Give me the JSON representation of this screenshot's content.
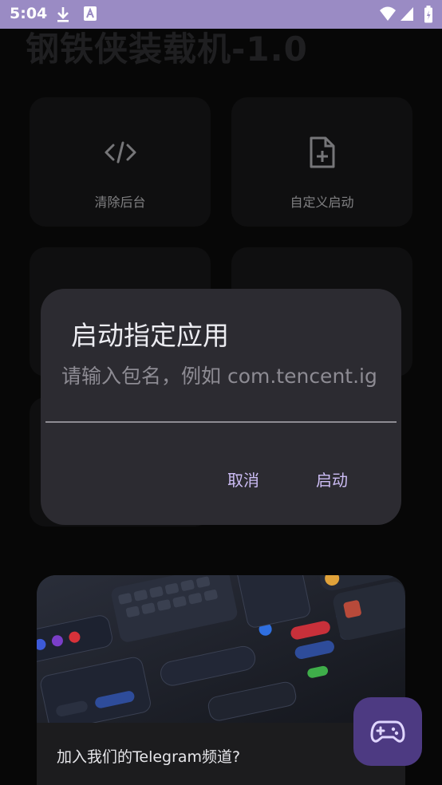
{
  "status_bar": {
    "time": "5:04",
    "icons": [
      "download-icon",
      "text-icon",
      "wifi-icon",
      "signal-icon",
      "battery-icon"
    ],
    "background": "#9a8bc4"
  },
  "app": {
    "title": "钢铁侠装载机-1.0"
  },
  "tiles": [
    {
      "label": "清除后台",
      "icon": "code-icon"
    },
    {
      "label": "自定义启动",
      "icon": "file-add-icon"
    }
  ],
  "dialog": {
    "title": "启动指定应用",
    "placeholder": "请输入包名，例如 com.tencent.ig",
    "cancel_label": "取消",
    "confirm_label": "启动",
    "accent": "#cdbdf5"
  },
  "banner": {
    "text": "加入我们的Telegram频道?"
  },
  "fab": {
    "icon": "gamepad-icon",
    "color": "#4d3a82"
  }
}
